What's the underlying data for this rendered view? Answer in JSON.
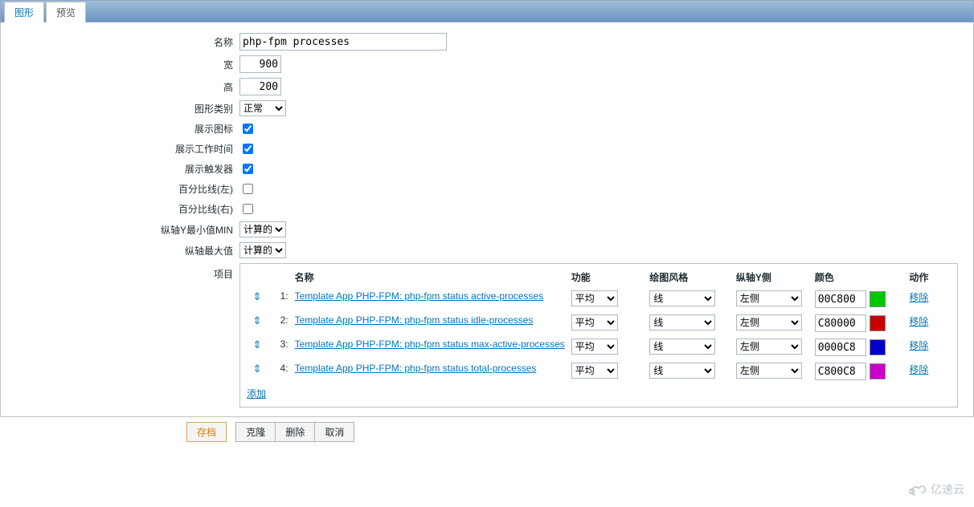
{
  "tabs": {
    "graph": "图形",
    "preview": "预览"
  },
  "labels": {
    "name": "名称",
    "width": "宽",
    "height": "高",
    "graph_type": "图形类别",
    "show_legend": "展示图标",
    "show_working_time": "展示工作时间",
    "show_triggers": "展示触发器",
    "percentile_left": "百分比线(左)",
    "percentile_right": "百分比线(右)",
    "yaxis_min": "纵轴Y最小值MIN",
    "yaxis_max": "纵轴最大值",
    "items": "项目",
    "add": "添加"
  },
  "form": {
    "name": "php-fpm processes",
    "width": "900",
    "height": "200",
    "graph_type": "正常",
    "show_legend": true,
    "show_working_time": true,
    "show_triggers": true,
    "percentile_left": false,
    "percentile_right": false,
    "yaxis_min": "计算的",
    "yaxis_max": "计算的"
  },
  "items_header": {
    "name": "名称",
    "function": "功能",
    "draw_style": "绘图风格",
    "yaxis_side": "纵轴Y侧",
    "color": "颜色",
    "action": "动作"
  },
  "options": {
    "function": "平均",
    "draw_style": "线",
    "yaxis_side": "左侧",
    "remove": "移除"
  },
  "items": [
    {
      "idx": "1:",
      "name": "Template App PHP-FPM: php-fpm status active-processes",
      "color": "00C800",
      "swatch": "#00c800"
    },
    {
      "idx": "2:",
      "name": "Template App PHP-FPM: php-fpm status idle-processes",
      "color": "C80000",
      "swatch": "#c80000"
    },
    {
      "idx": "3:",
      "name": "Template App PHP-FPM: php-fpm status max-active-processes",
      "color": "0000C8",
      "swatch": "#0000c8"
    },
    {
      "idx": "4:",
      "name": "Template App PHP-FPM: php-fpm status total-processes",
      "color": "C800C8",
      "swatch": "#c800c8"
    }
  ],
  "buttons": {
    "save": "存档",
    "clone": "克隆",
    "delete": "删除",
    "cancel": "取消"
  },
  "brand": "亿速云"
}
